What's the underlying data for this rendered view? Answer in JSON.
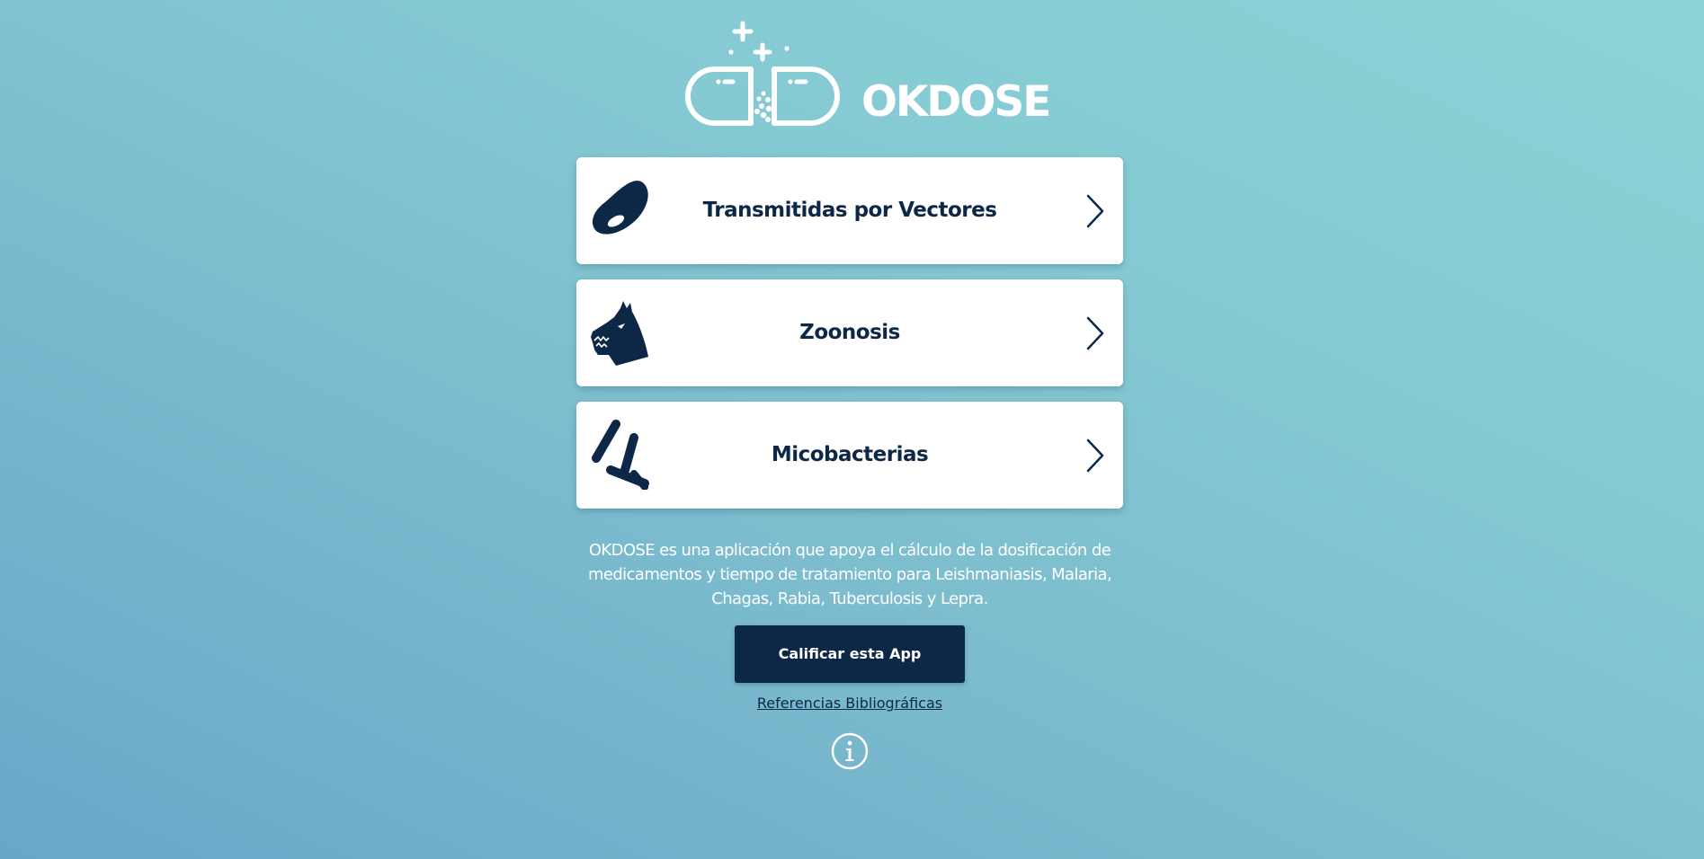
{
  "brand": {
    "name": "OKDOSE",
    "logo_icon": "pill-capsule-icon"
  },
  "menu": {
    "items": [
      {
        "label": "Transmitidas por Vectores",
        "icon": "leishmania-parasite-icon",
        "chevron": "chevron-right-icon"
      },
      {
        "label": "Zoonosis",
        "icon": "rabid-dog-icon",
        "chevron": "chevron-right-icon"
      },
      {
        "label": "Micobacterias",
        "icon": "bacilli-icon",
        "chevron": "chevron-right-icon"
      }
    ]
  },
  "description": "OKDOSE es una aplicación que apoya el cálculo de la dosificación de medicamentos y tiempo de tratamiento para Leishmaniasis, Malaria, Chagas, Rabia, Tuberculosis y Lepra.",
  "actions": {
    "rate_label": "Calificar esta App",
    "references_label": "Referencias Bibliográficas",
    "info_icon": "info-icon"
  },
  "colors": {
    "navy": "#0d2747",
    "card_bg": "#ffffff",
    "gradient_start": "#6aa6c8",
    "gradient_end": "#8ad3d6"
  }
}
